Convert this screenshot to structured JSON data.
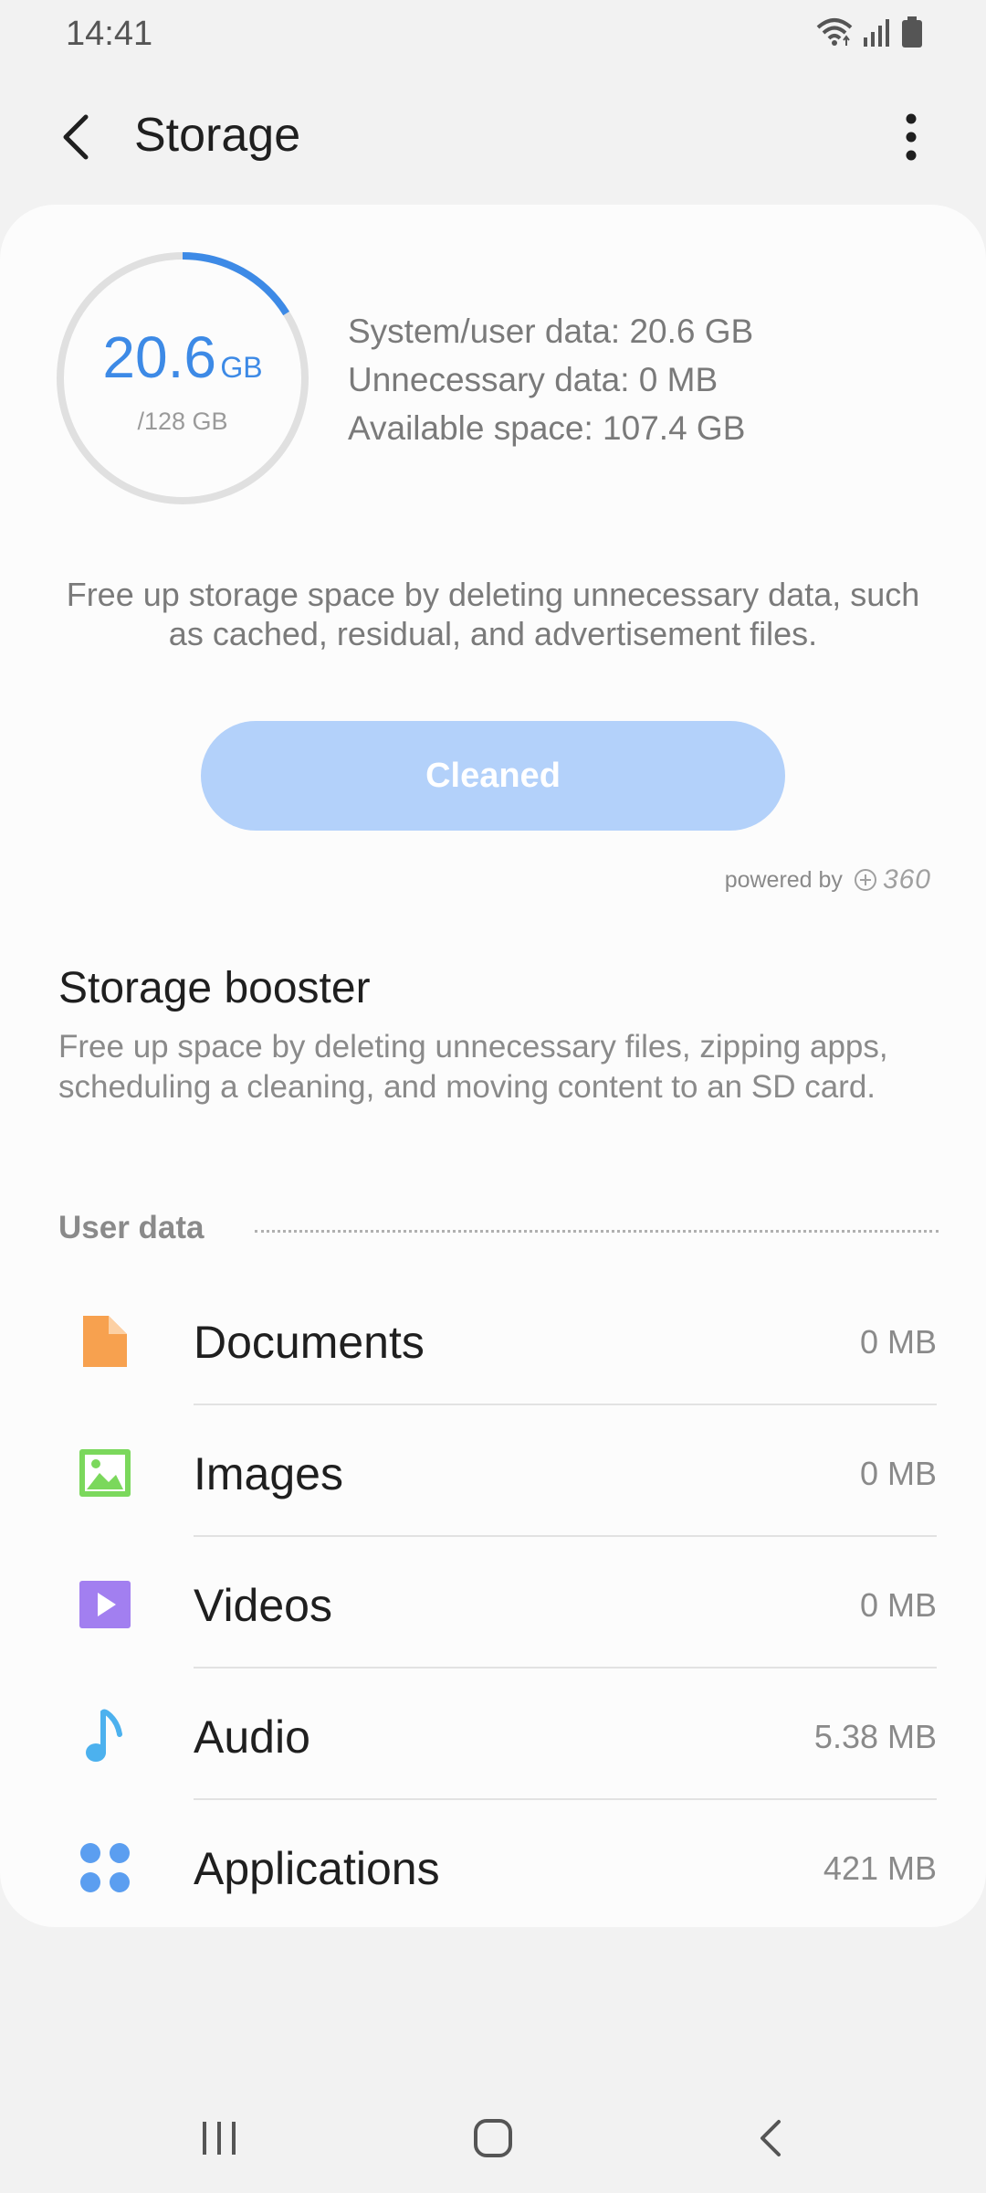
{
  "status_bar": {
    "time": "14:41",
    "icons": [
      "wifi-icon",
      "signal-icon",
      "battery-icon"
    ]
  },
  "app_bar": {
    "title": "Storage",
    "back_icon": "chevron-left-icon",
    "more_icon": "more-vertical-icon"
  },
  "summary": {
    "used_value": "20.6",
    "used_unit": "GB",
    "total": "/128 GB",
    "used_fraction": 0.161,
    "stats": {
      "system_user": "System/user data: 20.6 GB",
      "unnecessary": "Unnecessary data: 0 MB",
      "available": "Available space: 107.4 GB"
    }
  },
  "cleanup": {
    "description": "Free up storage space by deleting unnecessary data, such as cached, residual, and advertisement files.",
    "button_label": "Cleaned",
    "powered_by": "powered by",
    "brand": "360"
  },
  "booster": {
    "title": "Storage booster",
    "description": "Free up space by deleting unnecessary files, zipping apps, scheduling a cleaning, and moving content to an SD card."
  },
  "user_data": {
    "section_title": "User data",
    "items": [
      {
        "label": "Documents",
        "size": "0 MB",
        "icon": "document-icon",
        "color": "#f7a14f"
      },
      {
        "label": "Images",
        "size": "0 MB",
        "icon": "image-icon",
        "color": "#7bd85c"
      },
      {
        "label": "Videos",
        "size": "0 MB",
        "icon": "video-icon",
        "color": "#a27ff0"
      },
      {
        "label": "Audio",
        "size": "5.38 MB",
        "icon": "music-note-icon",
        "color": "#4cb1ee"
      },
      {
        "label": "Applications",
        "size": "421 MB",
        "icon": "apps-icon",
        "color": "#5b9ef0"
      }
    ]
  },
  "colors": {
    "accent": "#3d8ae6",
    "button_disabled": "#b3d1fa",
    "ring_track": "#e0e0e0"
  },
  "nav_bar": {
    "icons": [
      "recents-icon",
      "home-icon",
      "back-icon"
    ]
  }
}
